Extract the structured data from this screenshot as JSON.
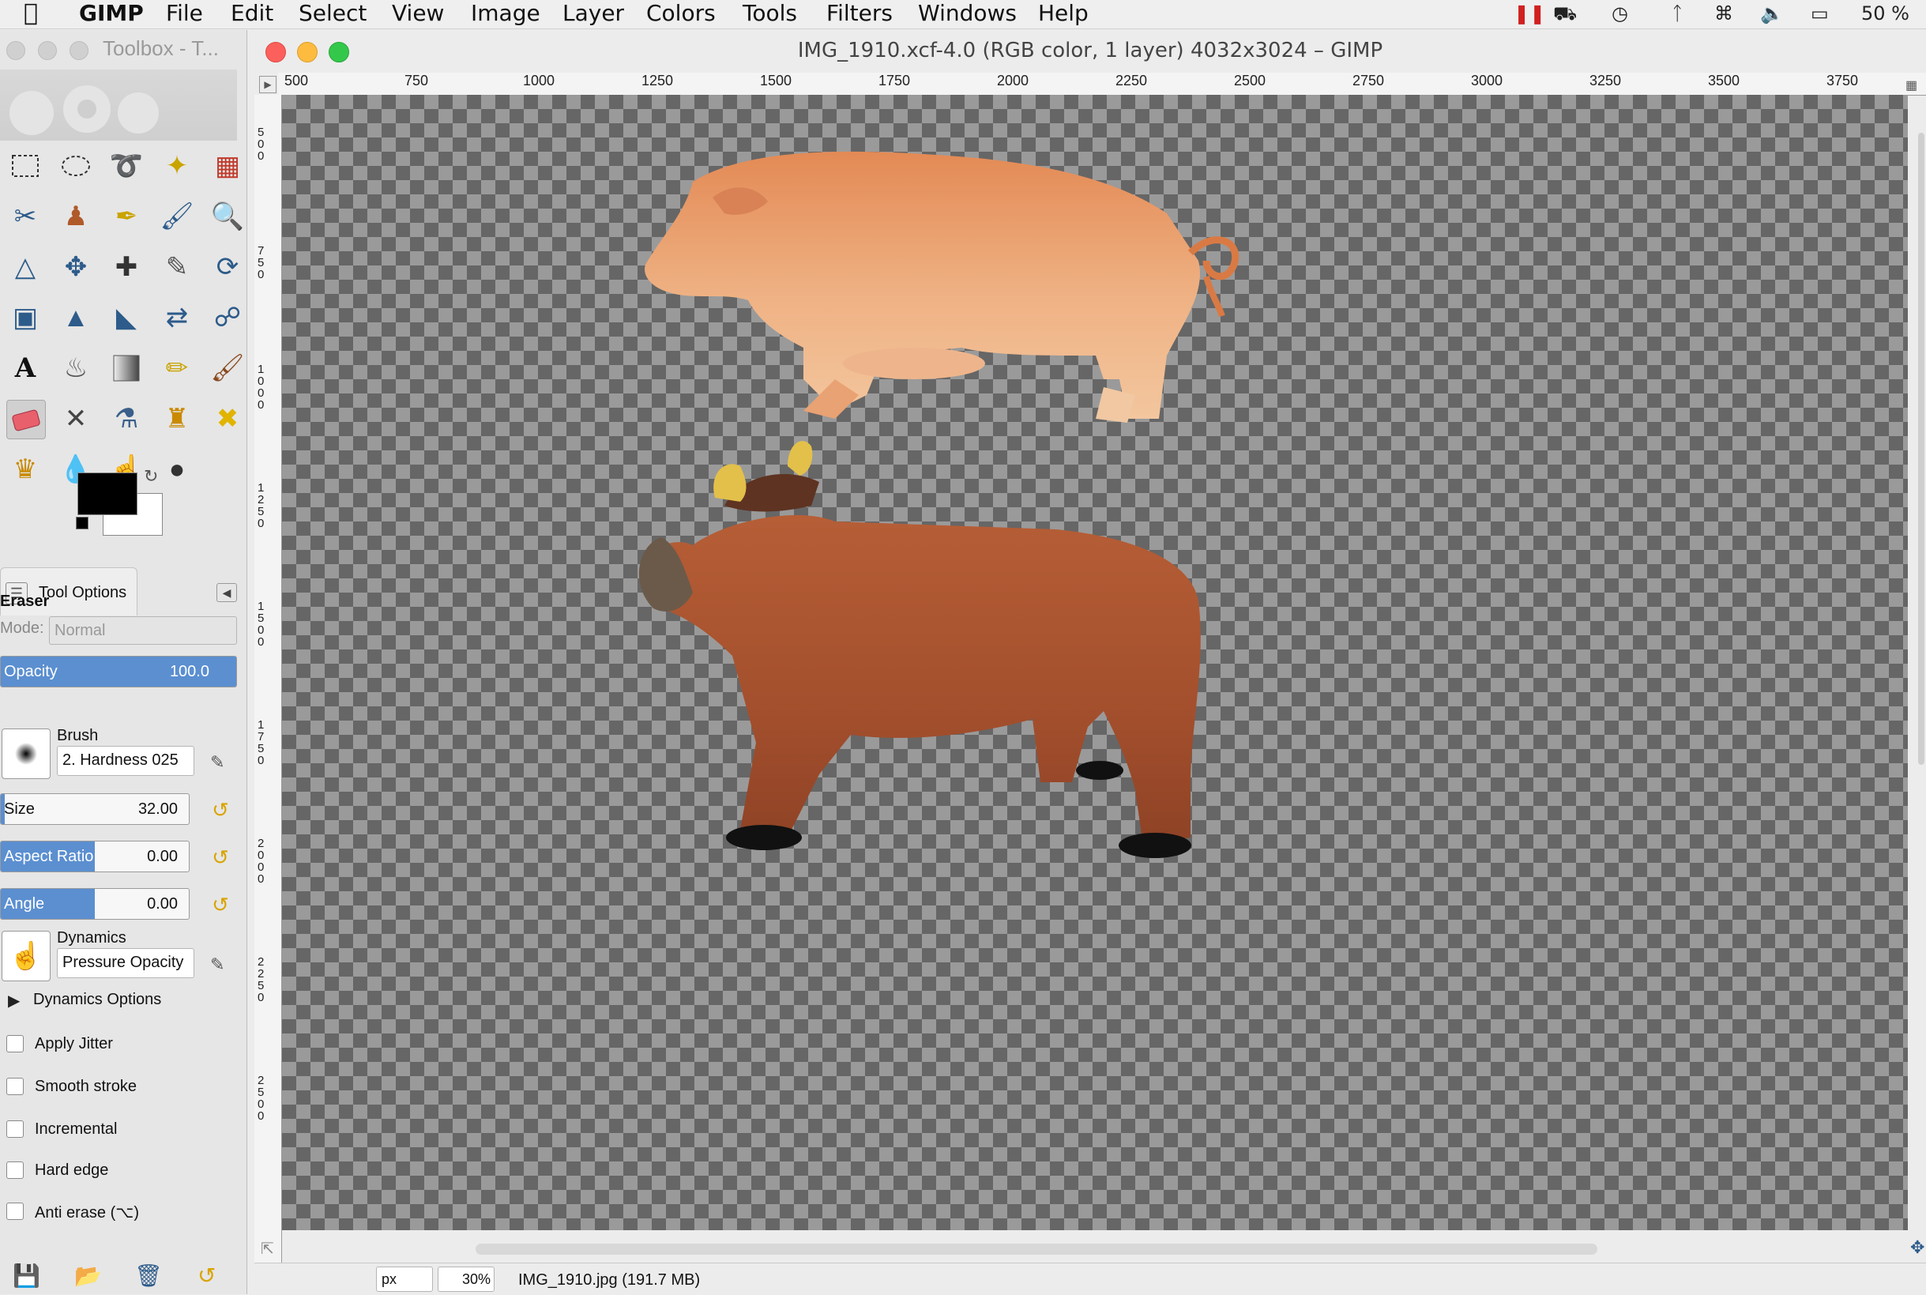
{
  "menubar": {
    "app": "GIMP",
    "items": [
      "File",
      "Edit",
      "Select",
      "View",
      "Image",
      "Layer",
      "Colors",
      "Tools",
      "Filters",
      "Windows",
      "Help"
    ],
    "battery": "50 %"
  },
  "toolbox": {
    "title": "Toolbox - T...",
    "tool_options_tab": "Tool Options"
  },
  "tool_options": {
    "tool_name": "Eraser",
    "mode_label": "Mode:",
    "mode_value": "Normal",
    "opacity_label": "Opacity",
    "opacity_value": "100.0",
    "opacity_fraction": 1.0,
    "brush_label": "Brush",
    "brush_value": "2. Hardness 025",
    "size_label": "Size",
    "size_value": "32.00",
    "size_fraction": 0.02,
    "aspect_label": "Aspect Ratio",
    "aspect_value": "0.00",
    "aspect_fraction": 0.5,
    "angle_label": "Angle",
    "angle_value": "0.00",
    "angle_fraction": 0.5,
    "dynamics_label": "Dynamics",
    "dynamics_value": "Pressure Opacity",
    "dynamics_options": "Dynamics Options",
    "checkboxes": [
      "Apply Jitter",
      "Smooth stroke",
      "Incremental",
      "Hard edge",
      "Anti erase  (⌥)"
    ]
  },
  "image_window": {
    "title": "IMG_1910.xcf-4.0 (RGB color, 1 layer) 4032x3024 – GIMP",
    "ruler_ticks": [
      "500",
      "750",
      "1000",
      "1250",
      "1500",
      "1750",
      "2000",
      "2250",
      "2500",
      "2750",
      "3000",
      "3250",
      "3500",
      "3750"
    ],
    "vruler_ticks": [
      "500",
      "750",
      "1000",
      "1250",
      "1500",
      "1750",
      "2000",
      "2250",
      "2500"
    ],
    "status_unit": "px",
    "zoom": "30%",
    "status_file": "IMG_1910.jpg (191.7 MB)"
  },
  "colors": {
    "selection_blue": "#5b8fd0",
    "pig": "#e9a06e",
    "bull": "#a4532f"
  }
}
